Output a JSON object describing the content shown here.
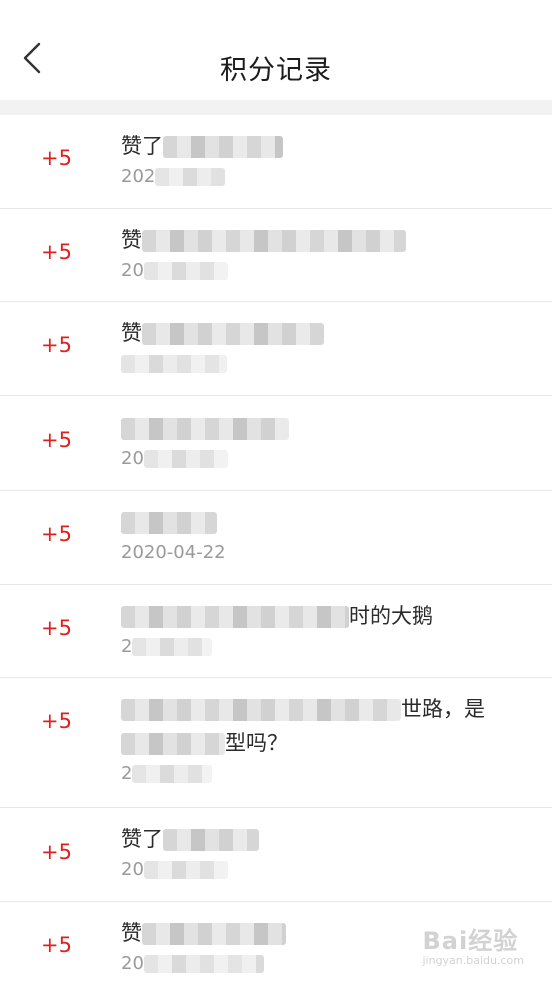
{
  "header": {
    "title": "积分记录"
  },
  "records": [
    {
      "points": "+5",
      "title_visible": "赞了",
      "title_after": "",
      "title_line2": "",
      "date_visible": "202"
    },
    {
      "points": "+5",
      "title_visible": "赞",
      "title_after": "",
      "title_line2": "",
      "date_visible": "20"
    },
    {
      "points": "+5",
      "title_visible": "赞",
      "title_after": "",
      "title_line2": "",
      "date_visible": ""
    },
    {
      "points": "+5",
      "title_visible": "",
      "title_after": "",
      "title_line2": "",
      "date_visible": "20"
    },
    {
      "points": "+5",
      "title_visible": "",
      "title_after": "",
      "title_line2": "",
      "date_visible": "2020-04-22"
    },
    {
      "points": "+5",
      "title_visible": "",
      "title_after": "时的大鹅",
      "title_line2": "",
      "date_visible": "2"
    },
    {
      "points": "+5",
      "title_visible": "",
      "title_after": "世路，是",
      "title_line2": "型吗？",
      "date_visible": "2"
    },
    {
      "points": "+5",
      "title_visible": "赞了",
      "title_after": "",
      "title_line2": "",
      "date_visible": "20"
    },
    {
      "points": "+5",
      "title_visible": "赞",
      "title_after": "",
      "title_line2": "",
      "date_visible": "20"
    }
  ],
  "watermark": {
    "text": "Bai经验",
    "sub": "jingyan.baidu.com"
  }
}
